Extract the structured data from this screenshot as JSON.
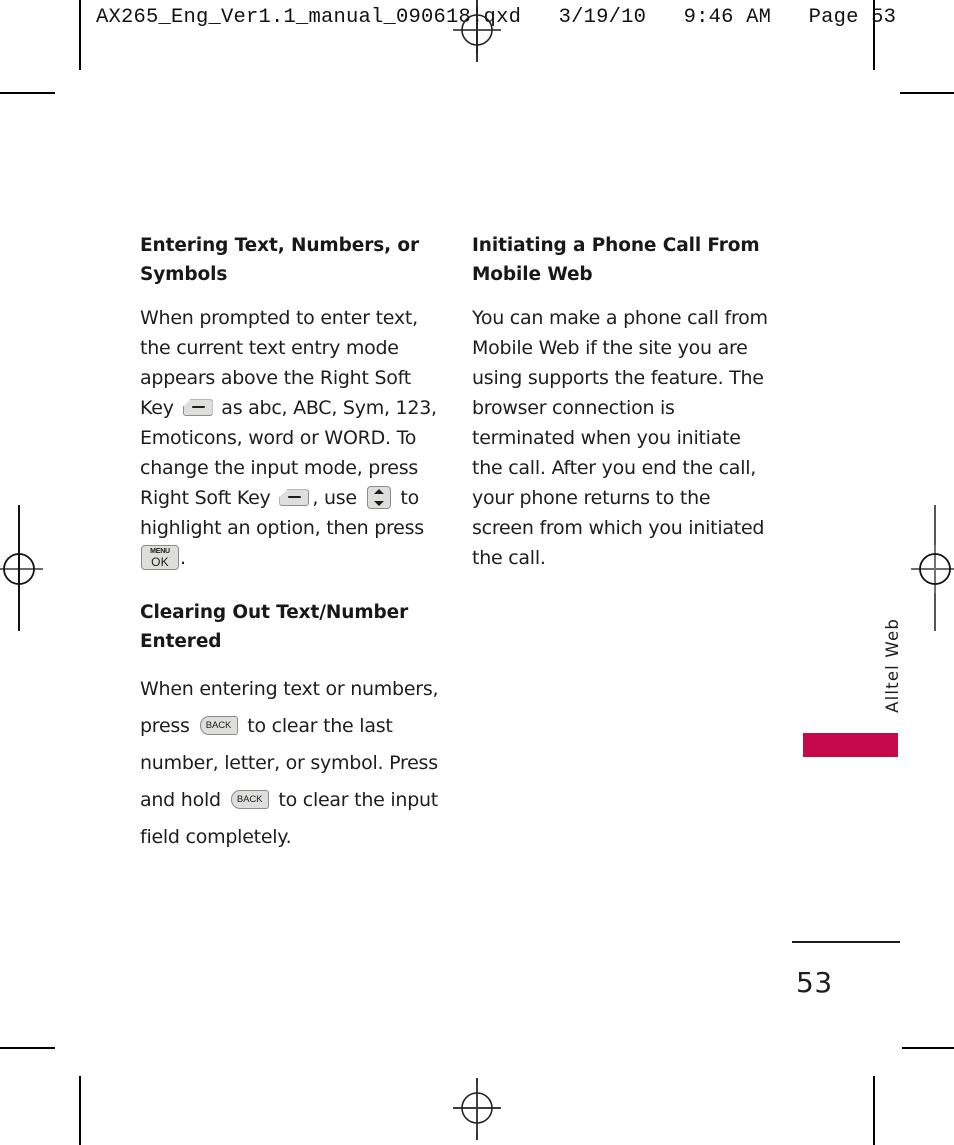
{
  "prepress": {
    "header_line": "AX265_Eng_Ver1.1_manual_090618.qxd   3/19/10   9:46 AM   Page 53"
  },
  "left_column": {
    "heading_1": "Entering Text, Numbers, or Symbols",
    "paragraph_1": {
      "part_1": "When prompted to enter text, the current text entry mode appears above the Right Soft Key",
      "part_2": "as abc, ABC, Sym, 123, Emoticons, word or WORD. To change the input mode, press Right Soft Key",
      "part_3": ", use",
      "part_4": "to highlight an option, then press",
      "part_5": "."
    },
    "heading_2": "Clearing Out Text/Number Entered",
    "paragraph_2": {
      "part_1": "When entering text or numbers, press",
      "part_2": "to clear the last number, letter, or symbol. Press and hold",
      "part_3": "to clear the input field completely."
    }
  },
  "right_column": {
    "heading_1": "Initiating a Phone Call From Mobile Web",
    "paragraph_1": "You can make a phone call from Mobile Web if the site you are using supports the feature. The browser connection is terminated when you initiate the call. After you end the call, your phone returns to the screen from which you initiated the call."
  },
  "keys": {
    "menu_label": "MENU",
    "ok_label": "OK",
    "back_label": "BACK"
  },
  "side_tab": {
    "label": "Alltel Web",
    "bar_color": "#C5094A"
  },
  "footer": {
    "page_number": "53"
  }
}
